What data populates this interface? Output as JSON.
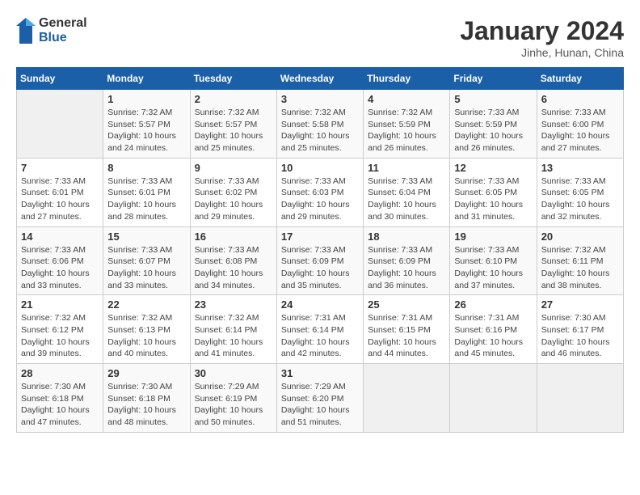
{
  "logo": {
    "general": "General",
    "blue": "Blue"
  },
  "header": {
    "month_title": "January 2024",
    "subtitle": "Jinhe, Hunan, China"
  },
  "days_of_week": [
    "Sunday",
    "Monday",
    "Tuesday",
    "Wednesday",
    "Thursday",
    "Friday",
    "Saturday"
  ],
  "weeks": [
    [
      {
        "day": "",
        "sunrise": "",
        "sunset": "",
        "daylight": ""
      },
      {
        "day": "1",
        "sunrise": "7:32 AM",
        "sunset": "5:57 PM",
        "daylight": "10 hours and 24 minutes."
      },
      {
        "day": "2",
        "sunrise": "7:32 AM",
        "sunset": "5:57 PM",
        "daylight": "10 hours and 25 minutes."
      },
      {
        "day": "3",
        "sunrise": "7:32 AM",
        "sunset": "5:58 PM",
        "daylight": "10 hours and 25 minutes."
      },
      {
        "day": "4",
        "sunrise": "7:32 AM",
        "sunset": "5:59 PM",
        "daylight": "10 hours and 26 minutes."
      },
      {
        "day": "5",
        "sunrise": "7:33 AM",
        "sunset": "5:59 PM",
        "daylight": "10 hours and 26 minutes."
      },
      {
        "day": "6",
        "sunrise": "7:33 AM",
        "sunset": "6:00 PM",
        "daylight": "10 hours and 27 minutes."
      }
    ],
    [
      {
        "day": "7",
        "sunrise": "7:33 AM",
        "sunset": "6:01 PM",
        "daylight": "10 hours and 27 minutes."
      },
      {
        "day": "8",
        "sunrise": "7:33 AM",
        "sunset": "6:01 PM",
        "daylight": "10 hours and 28 minutes."
      },
      {
        "day": "9",
        "sunrise": "7:33 AM",
        "sunset": "6:02 PM",
        "daylight": "10 hours and 29 minutes."
      },
      {
        "day": "10",
        "sunrise": "7:33 AM",
        "sunset": "6:03 PM",
        "daylight": "10 hours and 29 minutes."
      },
      {
        "day": "11",
        "sunrise": "7:33 AM",
        "sunset": "6:04 PM",
        "daylight": "10 hours and 30 minutes."
      },
      {
        "day": "12",
        "sunrise": "7:33 AM",
        "sunset": "6:05 PM",
        "daylight": "10 hours and 31 minutes."
      },
      {
        "day": "13",
        "sunrise": "7:33 AM",
        "sunset": "6:05 PM",
        "daylight": "10 hours and 32 minutes."
      }
    ],
    [
      {
        "day": "14",
        "sunrise": "7:33 AM",
        "sunset": "6:06 PM",
        "daylight": "10 hours and 33 minutes."
      },
      {
        "day": "15",
        "sunrise": "7:33 AM",
        "sunset": "6:07 PM",
        "daylight": "10 hours and 33 minutes."
      },
      {
        "day": "16",
        "sunrise": "7:33 AM",
        "sunset": "6:08 PM",
        "daylight": "10 hours and 34 minutes."
      },
      {
        "day": "17",
        "sunrise": "7:33 AM",
        "sunset": "6:09 PM",
        "daylight": "10 hours and 35 minutes."
      },
      {
        "day": "18",
        "sunrise": "7:33 AM",
        "sunset": "6:09 PM",
        "daylight": "10 hours and 36 minutes."
      },
      {
        "day": "19",
        "sunrise": "7:33 AM",
        "sunset": "6:10 PM",
        "daylight": "10 hours and 37 minutes."
      },
      {
        "day": "20",
        "sunrise": "7:32 AM",
        "sunset": "6:11 PM",
        "daylight": "10 hours and 38 minutes."
      }
    ],
    [
      {
        "day": "21",
        "sunrise": "7:32 AM",
        "sunset": "6:12 PM",
        "daylight": "10 hours and 39 minutes."
      },
      {
        "day": "22",
        "sunrise": "7:32 AM",
        "sunset": "6:13 PM",
        "daylight": "10 hours and 40 minutes."
      },
      {
        "day": "23",
        "sunrise": "7:32 AM",
        "sunset": "6:14 PM",
        "daylight": "10 hours and 41 minutes."
      },
      {
        "day": "24",
        "sunrise": "7:31 AM",
        "sunset": "6:14 PM",
        "daylight": "10 hours and 42 minutes."
      },
      {
        "day": "25",
        "sunrise": "7:31 AM",
        "sunset": "6:15 PM",
        "daylight": "10 hours and 44 minutes."
      },
      {
        "day": "26",
        "sunrise": "7:31 AM",
        "sunset": "6:16 PM",
        "daylight": "10 hours and 45 minutes."
      },
      {
        "day": "27",
        "sunrise": "7:30 AM",
        "sunset": "6:17 PM",
        "daylight": "10 hours and 46 minutes."
      }
    ],
    [
      {
        "day": "28",
        "sunrise": "7:30 AM",
        "sunset": "6:18 PM",
        "daylight": "10 hours and 47 minutes."
      },
      {
        "day": "29",
        "sunrise": "7:30 AM",
        "sunset": "6:18 PM",
        "daylight": "10 hours and 48 minutes."
      },
      {
        "day": "30",
        "sunrise": "7:29 AM",
        "sunset": "6:19 PM",
        "daylight": "10 hours and 50 minutes."
      },
      {
        "day": "31",
        "sunrise": "7:29 AM",
        "sunset": "6:20 PM",
        "daylight": "10 hours and 51 minutes."
      },
      {
        "day": "",
        "sunrise": "",
        "sunset": "",
        "daylight": ""
      },
      {
        "day": "",
        "sunrise": "",
        "sunset": "",
        "daylight": ""
      },
      {
        "day": "",
        "sunrise": "",
        "sunset": "",
        "daylight": ""
      }
    ]
  ]
}
